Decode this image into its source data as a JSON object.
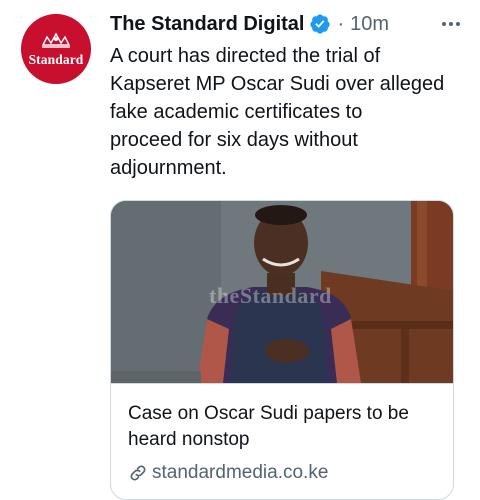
{
  "tweet": {
    "author": {
      "avatar_text": "Standard",
      "name": "The Standard Digital",
      "verified_icon": "verified-badge-icon"
    },
    "separator": "·",
    "timestamp": "10m",
    "more_icon": "more-options-icon",
    "text": "A court has directed the trial of\nKapseret MP Oscar Sudi over alleged\nfake academic certificates to\nproceed for six days without\nadjournment.",
    "card": {
      "image_watermark": "theStandard",
      "title": "Case on Oscar Sudi papers to be heard nonstop",
      "domain": "standardmedia.co.ke",
      "link_icon": "link-icon"
    }
  },
  "colors": {
    "brand_red": "#c8102e",
    "verified_blue": "#1d9bf0",
    "text_primary": "#0f1419",
    "text_secondary": "#536471",
    "card_border": "#cfd9de"
  }
}
